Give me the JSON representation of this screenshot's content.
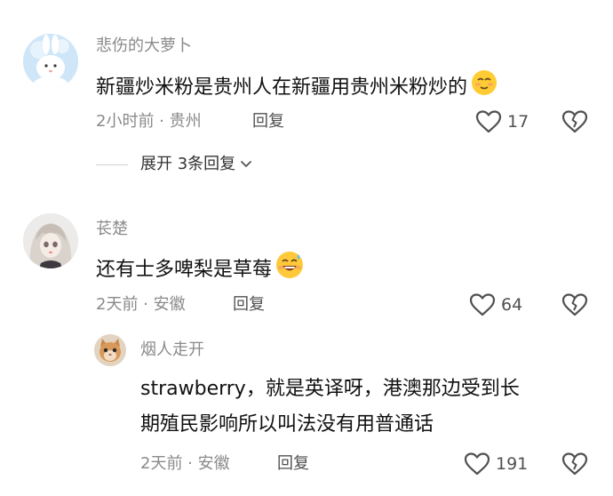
{
  "comments": [
    {
      "username": "悲伤的大萝卜",
      "text": "新疆炒米粉是贵州人在新疆用贵州米粉炒的",
      "emoji": "smiling-face-emoji",
      "meta": "2小时前 · 贵州",
      "reply_label": "回复",
      "likes": "17",
      "avatar": "cartoon-rabbit-avatar"
    },
    {
      "username": "苌楚",
      "text": "还有士多啤梨是草莓",
      "emoji": "grinning-sweat-emoji",
      "meta": "2天前 · 安徽",
      "reply_label": "回复",
      "likes": "64",
      "avatar": "anime-girl-avatar"
    }
  ],
  "expand_replies": "展开 3条回复",
  "reply": {
    "username": "烟人走开",
    "text_line1": "strawberry，就是英译呀，港澳那边受到长",
    "text_line2": "期殖民影响所以叫法没有用普通话",
    "meta": "2天前 · 安徽",
    "reply_label": "回复",
    "likes": "191",
    "avatar": "cat-avatar"
  },
  "icons": {
    "like": "heart-outline-icon",
    "dislike": "broken-heart-icon",
    "expand": "chevron-down-icon"
  },
  "colors": {
    "text_primary": "#111111",
    "text_secondary": "#8a8a8a",
    "action_text": "#505050",
    "background": "#ffffff"
  }
}
